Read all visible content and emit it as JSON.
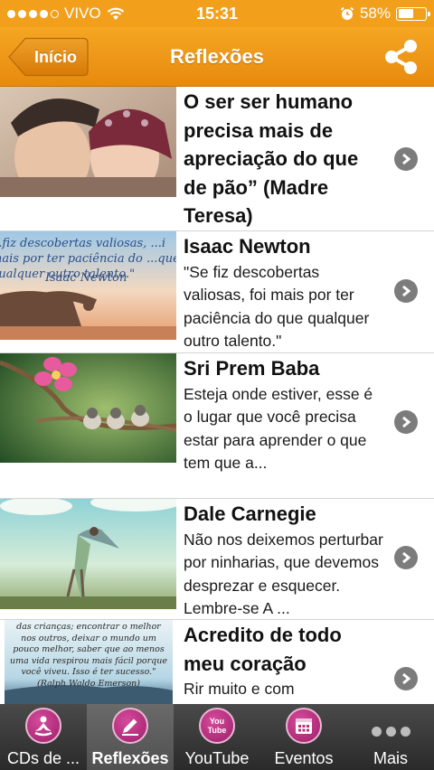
{
  "status_bar": {
    "carrier": "VIVO",
    "time": "15:31",
    "battery": "58%",
    "battery_level": 0.58
  },
  "nav": {
    "back_label": "Início",
    "title": "Reflexões"
  },
  "items": [
    {
      "title": "O ser ser humano precisa mais de apreciação do que de pão” (Madre Teresa)",
      "body": ""
    },
    {
      "title": "Isaac Newton",
      "body": "\"Se fiz descobertas valiosas, foi mais por ter paciência do que qualquer outro talento.\"",
      "thumb_text": "...fiz descobertas valiosas, ...i mais por ter paciência do ...que qualquer outro talento.\"",
      "thumb_caption": "Isaac Newton"
    },
    {
      "title": "Sri Prem Baba",
      "body": "Esteja onde estiver, esse é o lugar que você precisa estar para aprender o que tem que a..."
    },
    {
      "title": "Dale Carnegie",
      "body": "Não nos deixemos perturbar por ninharias, que devemos desprezar e esquecer. Lembre-se A ..."
    },
    {
      "title": "Acredito de todo meu coração",
      "body": "Rir muito e com",
      "thumb_text": "das crianças; encontrar o melhor nos outros, deixar o mundo um pouco melhor, saber que ao menos uma vida respirou mais fácil porque você viveu. Isso é ter sucesso.\" (Ralph Waldo Emerson)"
    }
  ],
  "tabs": [
    {
      "label": "CDs de ...",
      "icon": "meditation-icon"
    },
    {
      "label": "Reflexões",
      "icon": "pencil-icon"
    },
    {
      "label": "YouTube",
      "icon": "youtube-icon",
      "icon_text": "You Tube"
    },
    {
      "label": "Eventos",
      "icon": "calendar-icon"
    },
    {
      "label": "Mais",
      "icon": "more-icon"
    }
  ],
  "colors": {
    "accent": "#f2a01c",
    "tab_icon": "#b8307f",
    "tab_bar": "#3a3a3a"
  }
}
